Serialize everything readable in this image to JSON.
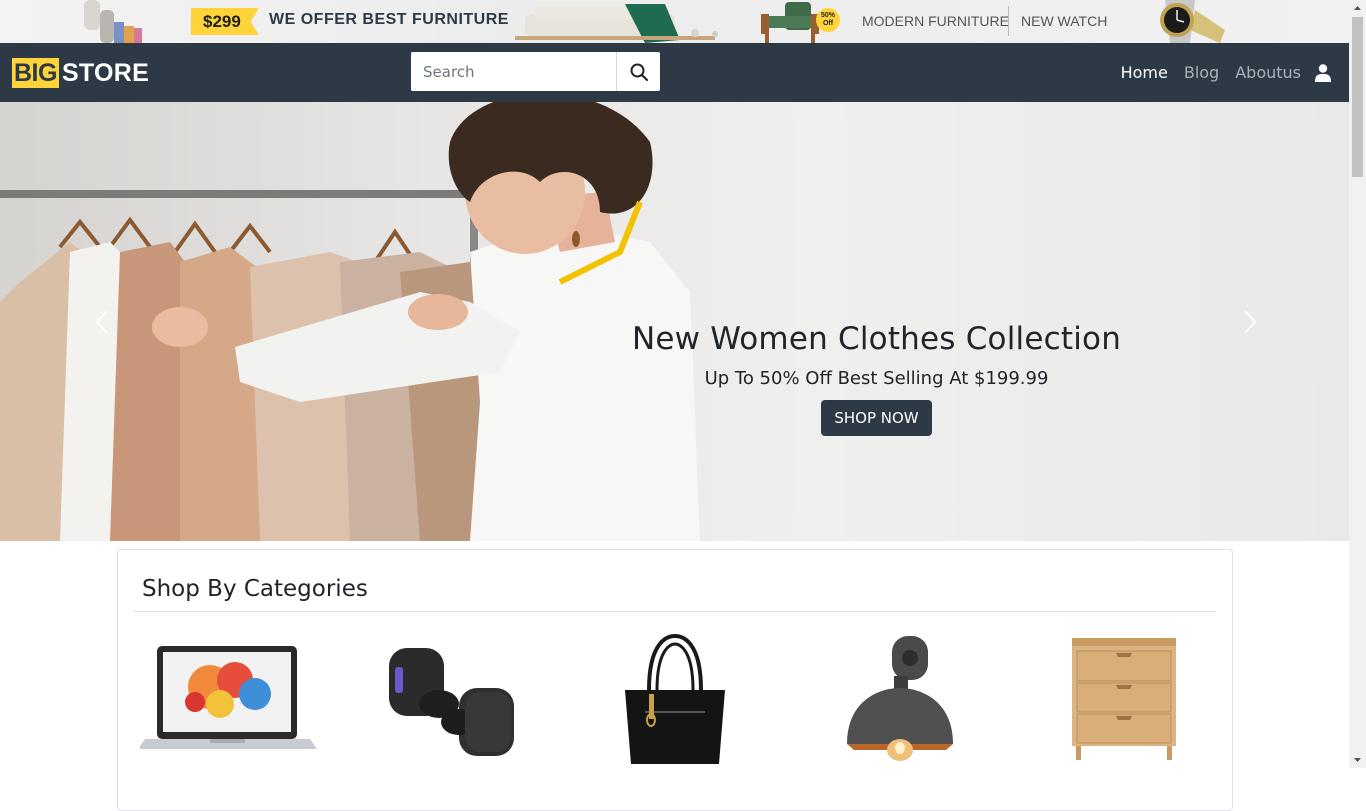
{
  "promo": {
    "price": "$299",
    "offer": "WE OFFER BEST FURNITURE",
    "badge": "50% Off",
    "link_furniture": "MODERN FURNITURE",
    "link_watch": "NEW WATCH"
  },
  "navbar": {
    "logo_big": "BIG",
    "logo_store": "STORE",
    "search_placeholder": "Search",
    "links": [
      {
        "label": "Home",
        "active": true
      },
      {
        "label": "Blog",
        "active": false
      },
      {
        "label": "Aboutus",
        "active": false
      }
    ]
  },
  "hero": {
    "title": "New Women Clothes Collection",
    "subtitle": "Up To 50% Off Best Selling At $199.99",
    "cta": "SHOP NOW"
  },
  "categories": {
    "title": "Shop By Categories",
    "items": [
      {
        "icon": "laptop-image"
      },
      {
        "icon": "earbuds-image"
      },
      {
        "icon": "handbag-image"
      },
      {
        "icon": "wall-lamp-image"
      },
      {
        "icon": "drawer-cabinet-image"
      }
    ]
  },
  "colors": {
    "navbar": "#2d3a46",
    "accent": "#ffd43b"
  }
}
